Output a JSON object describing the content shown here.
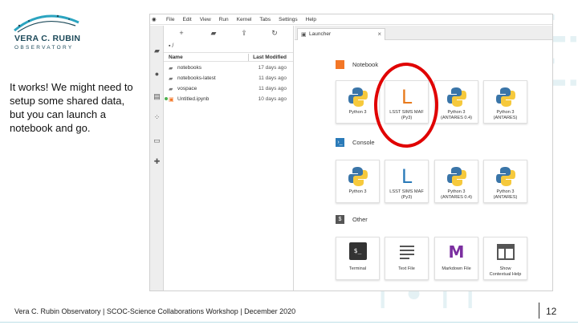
{
  "logo": {
    "title": "VERA C. RUBIN",
    "subtitle": "OBSERVATORY"
  },
  "caption": "It works! We might need to setup some shared data, but you can launch a notebook and go.",
  "jupyter": {
    "menu": [
      "File",
      "Edit",
      "View",
      "Run",
      "Kernel",
      "Tabs",
      "Settings",
      "Help"
    ],
    "breadcrumb": "▪ /",
    "file_browser": {
      "col_name": "Name",
      "col_modified": "Last Modified",
      "rows": [
        {
          "name": "notebooks",
          "modified": "17 days ago",
          "type": "folder"
        },
        {
          "name": "notebooks-latest",
          "modified": "11 days ago",
          "type": "folder"
        },
        {
          "name": "vospace",
          "modified": "11 days ago",
          "type": "folder"
        },
        {
          "name": "Untitled.ipynb",
          "modified": "10 days ago",
          "type": "notebook"
        }
      ]
    },
    "tab_label": "Launcher",
    "launcher": {
      "notebook_section": "Notebook",
      "console_section": "Console",
      "other_section": "Other",
      "notebook_cards": [
        {
          "l1": "Python 3",
          "l2": "",
          "icon": "python-logo"
        },
        {
          "l1": "LSST SIMS MAF",
          "l2": "(Py3)",
          "icon": "lsst-L"
        },
        {
          "l1": "Python 3",
          "l2": "(ANTARES 0.4)",
          "icon": "python-logo"
        },
        {
          "l1": "Python 3",
          "l2": "(ANTARES)",
          "icon": "python-logo"
        }
      ],
      "console_cards": [
        {
          "l1": "Python 3",
          "l2": "",
          "icon": "python-logo"
        },
        {
          "l1": "LSST SIMS MAF",
          "l2": "(Py3)",
          "icon": "lsst-L"
        },
        {
          "l1": "Python 3",
          "l2": "(ANTARES 0.4)",
          "icon": "python-logo"
        },
        {
          "l1": "Python 3",
          "l2": "(ANTARES)",
          "icon": "python-logo"
        }
      ],
      "other_cards": [
        {
          "l1": "Terminal",
          "l2": "",
          "icon": "terminal-icon"
        },
        {
          "l1": "Text File",
          "l2": "",
          "icon": "text-file-icon"
        },
        {
          "l1": "Markdown File",
          "l2": "",
          "icon": "markdown-icon"
        },
        {
          "l1": "Show",
          "l2": "Contextual Help",
          "icon": "help-window-icon"
        }
      ]
    }
  },
  "footer": "Vera C. Rubin Observatory | SCOC-Science Collaborations Workshop | December 2020",
  "page_number": "12",
  "colors": {
    "brand": "#1d4a5a",
    "annotation": "#e00000",
    "jupyter_orange": "#f37626",
    "lsst_orange": "#e87a1c",
    "lsst_blue": "#2a7ab8"
  }
}
